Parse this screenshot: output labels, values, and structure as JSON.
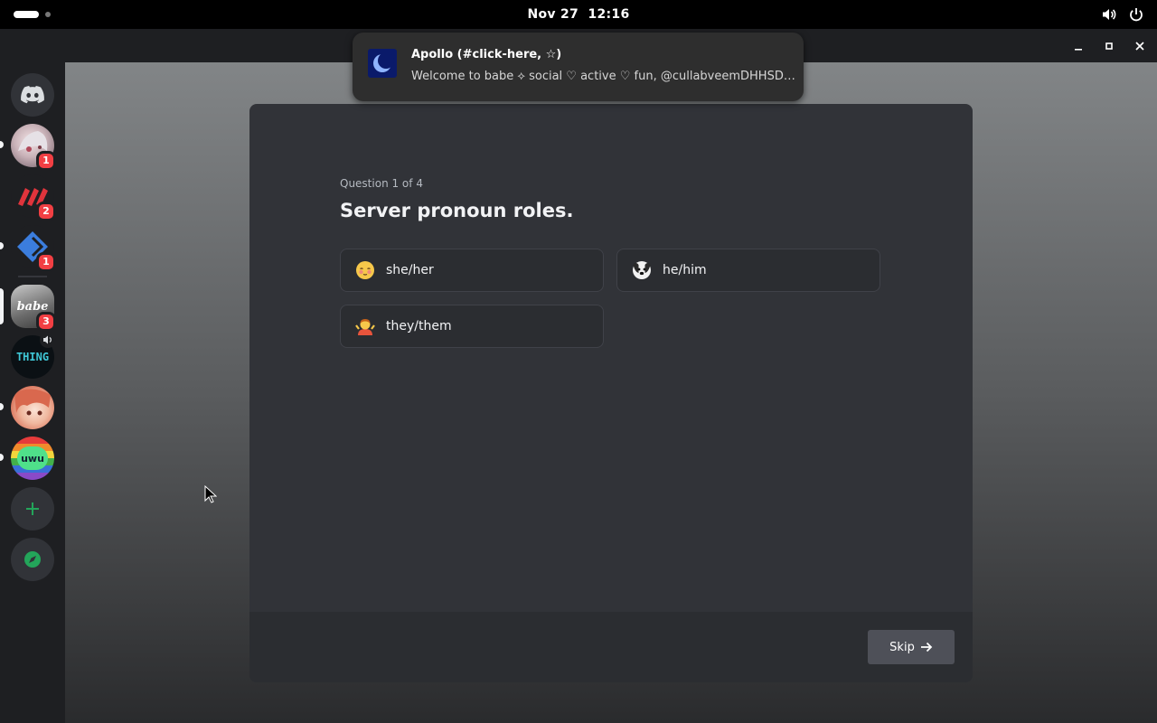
{
  "topbar": {
    "date": "Nov 27",
    "time": "12:16",
    "tray_icons": [
      "volume-icon",
      "power-icon"
    ]
  },
  "servers": [
    {
      "name": "home",
      "icon": "discord-logo-icon"
    },
    {
      "name": "anime-server",
      "badge": "1",
      "unread": true
    },
    {
      "name": "red-logo-server",
      "badge": "2"
    },
    {
      "name": "blue-diamond-server",
      "badge": "1",
      "unread": true
    },
    {
      "name": "babe-server",
      "badge": "3",
      "selected": true,
      "logo_text": "babe"
    },
    {
      "name": "thing-server",
      "logo_text": "THING",
      "voice": true
    },
    {
      "name": "redhead-server",
      "unread": true
    },
    {
      "name": "rainbow-cat-server",
      "logo_text": "uwu",
      "unread": true
    },
    {
      "name": "add-server",
      "icon": "plus-icon"
    },
    {
      "name": "explore-servers",
      "icon": "compass-icon"
    }
  ],
  "notification": {
    "title": "Apollo (#click-here, ☆)",
    "body": "Welcome to babe ⟡ social ♡ active ♡ fun, @cullabveemDHHSD…"
  },
  "onboarding": {
    "counter": "Question 1 of 4",
    "question": "Server pronoun roles.",
    "options": [
      {
        "label": "she/her",
        "emoji": "blushing-face-icon"
      },
      {
        "label": "he/him",
        "emoji": "dog-face-icon"
      },
      {
        "label": "they/them",
        "emoji": "shrugging-person-icon"
      }
    ],
    "skip_label": "Skip"
  },
  "colors": {
    "modal_bg": "#313338",
    "footer_bg": "#2b2d31",
    "badge_red": "#f23f43",
    "accent_green": "#23a55a"
  }
}
